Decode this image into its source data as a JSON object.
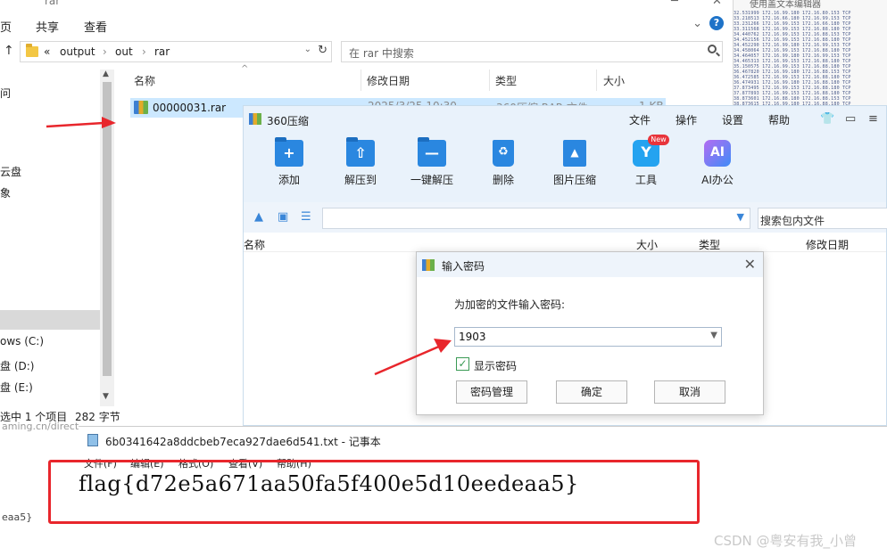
{
  "explorer": {
    "title_fragment": "rar",
    "ribbon": [
      "页",
      "共享",
      "查看"
    ],
    "breadcrumb": [
      "«",
      "output",
      "out",
      "rar"
    ],
    "search_placeholder": "在 rar 中搜索",
    "nav_items": [
      "问",
      "云盘",
      "象",
      "ows (C:)",
      "盘 (D:)",
      "盘 (E:)"
    ],
    "columns": [
      "名称",
      "修改日期",
      "类型",
      "大小"
    ],
    "file": {
      "name": "00000031.rar",
      "date": "2025/3/25 10:30",
      "type": "360压缩 RAR 文件",
      "size": "1 KB"
    },
    "status": {
      "selected": "选中 1 个项目",
      "size": "282 字节"
    }
  },
  "bg_editor": {
    "title": "使用盖文本编辑器",
    "lines": [
      "32.531999 172.16.99.180   172.16.80.153  TCP",
      "33.218513 172.16.66.180   172.16.99.153  TCP",
      "33.231266 172.16.99.153   172.16.66.180  TCP",
      "33.311568 172.16.99.153   172.16.88.180  TCP",
      "34.440762 172.16.99.153   172.16.88.153  TCP",
      "34.452156 172.16.99.153   172.16.88.180  TCP",
      "34.452290 172.16.99.180   172.16.99.153  TCP",
      "34.458064 172.16.99.153   172.16.88.180  TCP",
      "34.464057 172.16.99.180   172.16.99.153  TCP",
      "34.465313 172.16.99.153   172.16.88.180  TCP",
      "35.150575 172.16.99.153   172.16.88.180  TCP",
      "36.467820 172.16.99.180   172.16.88.153  TCP",
      "36.472585 172.16.99.153   172.16.88.180  TCP",
      "36.474931 172.16.99.180   172.16.88.180  TCP",
      "37.873495 172.16.99.153   172.16.88.180  TCP",
      "37.877893 172.16.99.153   172.16.88.180  TCP",
      "38.873601 172.16.88.180   172.16.88.153  TCP",
      "38.873615 172.16.99.180   172.16.88.180  TCP"
    ]
  },
  "archiver": {
    "title": "360压缩",
    "menu": [
      "文件",
      "操作",
      "设置",
      "帮助"
    ],
    "tools": [
      {
        "label": "添加",
        "icon": "add-folder-icon",
        "glyph": "+"
      },
      {
        "label": "解压到",
        "icon": "extract-to-icon",
        "glyph": "⇧"
      },
      {
        "label": "一键解压",
        "icon": "one-click-extract-icon",
        "glyph": "—"
      },
      {
        "label": "删除",
        "icon": "delete-bin-icon",
        "glyph": "♻"
      },
      {
        "label": "图片压缩",
        "icon": "image-compress-icon",
        "glyph": "▲"
      },
      {
        "label": "工具",
        "icon": "tools-icon",
        "glyph": "Y"
      },
      {
        "label": "AI办公",
        "icon": "ai-office-icon",
        "glyph": "AI"
      }
    ],
    "new_badge": "New",
    "search_placeholder": "搜索包内文件",
    "columns": [
      "名称",
      "大小",
      "类型",
      "修改日期"
    ]
  },
  "password_dialog": {
    "title": "输入密码",
    "prompt": "为加密的文件输入密码:",
    "password_value": "1903",
    "show_password_label": "显示密码",
    "show_password_checked": true,
    "buttons": [
      "密码管理",
      "确定",
      "取消"
    ]
  },
  "notepad": {
    "title": "6b0341642a8ddcbeb7eca927dae6d541.txt - 记事本",
    "menu": [
      "文件(F)",
      "编辑(E)",
      "格式(O)",
      "查看(V)",
      "帮助(H)"
    ],
    "content": "flag{d72e5a671aa50fa5f400e5d10eedeaa5}"
  },
  "left_fragment": [
    "aming.cn/direct",
    "eaa5}"
  ],
  "watermark": "CSDN @粤安有我_小曾",
  "colors": {
    "highlight": "#e8262c",
    "accent": "#2a87e0",
    "selection": "#cce8ff"
  }
}
